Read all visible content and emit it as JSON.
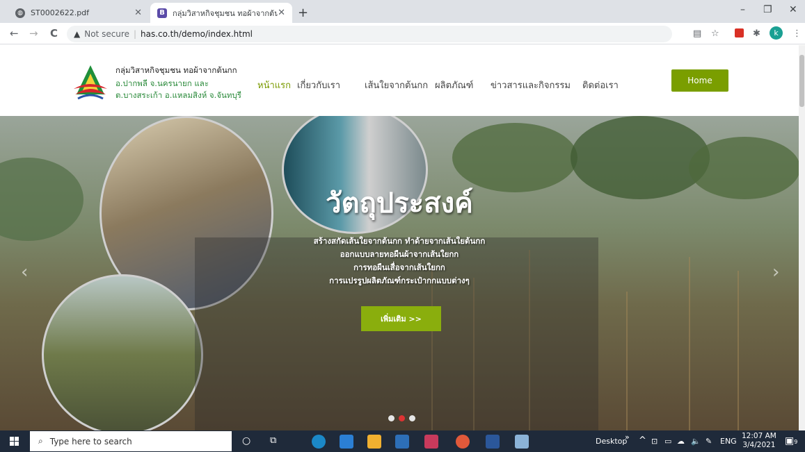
{
  "browser": {
    "tabs": [
      {
        "title": "ST0002622.pdf",
        "icon": "globe-icon"
      },
      {
        "title": "กลุ่มวิสาหกิจชุมชน ทอผ้าจากต้นกก",
        "icon": "bootstrap-b-icon"
      }
    ],
    "new_tab": "+",
    "window_controls": {
      "minimize": "–",
      "restore": "❐",
      "close": "✕"
    },
    "nav": {
      "back": "←",
      "forward": "→",
      "reload": "C"
    },
    "security_label": "Not secure",
    "url": "has.co.th/demo/index.html",
    "profile_initial": "k"
  },
  "site": {
    "logo_lines": [
      "กลุ่มวิสาหกิจชุมชน ทอผ้าจากต้นกก",
      "อ.ปากพลี จ.นครนายก และ",
      "ต.บางสระเก้า อ.แหลมสิงห์ จ.จันทบุรี"
    ],
    "nav": [
      "หน้าแรก",
      "เกี่ยวกับเรา",
      "เส้นใยจากต้นกก",
      "ผลิตภัณฑ์",
      "ข่าวสารและกิจกรรม",
      "ติดต่อเรา"
    ],
    "home_button": "Home",
    "accent": "#7a9e00"
  },
  "slider": {
    "title": "วัตถุประสงค์",
    "lines": [
      "สร้างสกัดเส้นใยจากต้นกก ทำด้ายจากเส้นใยต้นกก",
      "ออกแบบลายทอผืนผ้าจากเส้นใยกก",
      "การทอผืนเสื่อจากเส้นใยกก",
      "การแปรรูปผลิตภัณฑ์กระเป๋ากกแบบต่างๆ"
    ],
    "more_button": "เพิ่มเติม >>",
    "prev": "‹",
    "next": "›",
    "dots": 3,
    "active_dot": 2
  },
  "taskbar": {
    "search_placeholder": "Type here to search",
    "tray_desktop": "Desktop",
    "tray_more": "»",
    "tray_caret": "^",
    "language": "ENG",
    "time": "12:07 AM",
    "date": "3/4/2021",
    "notifications": "9"
  }
}
